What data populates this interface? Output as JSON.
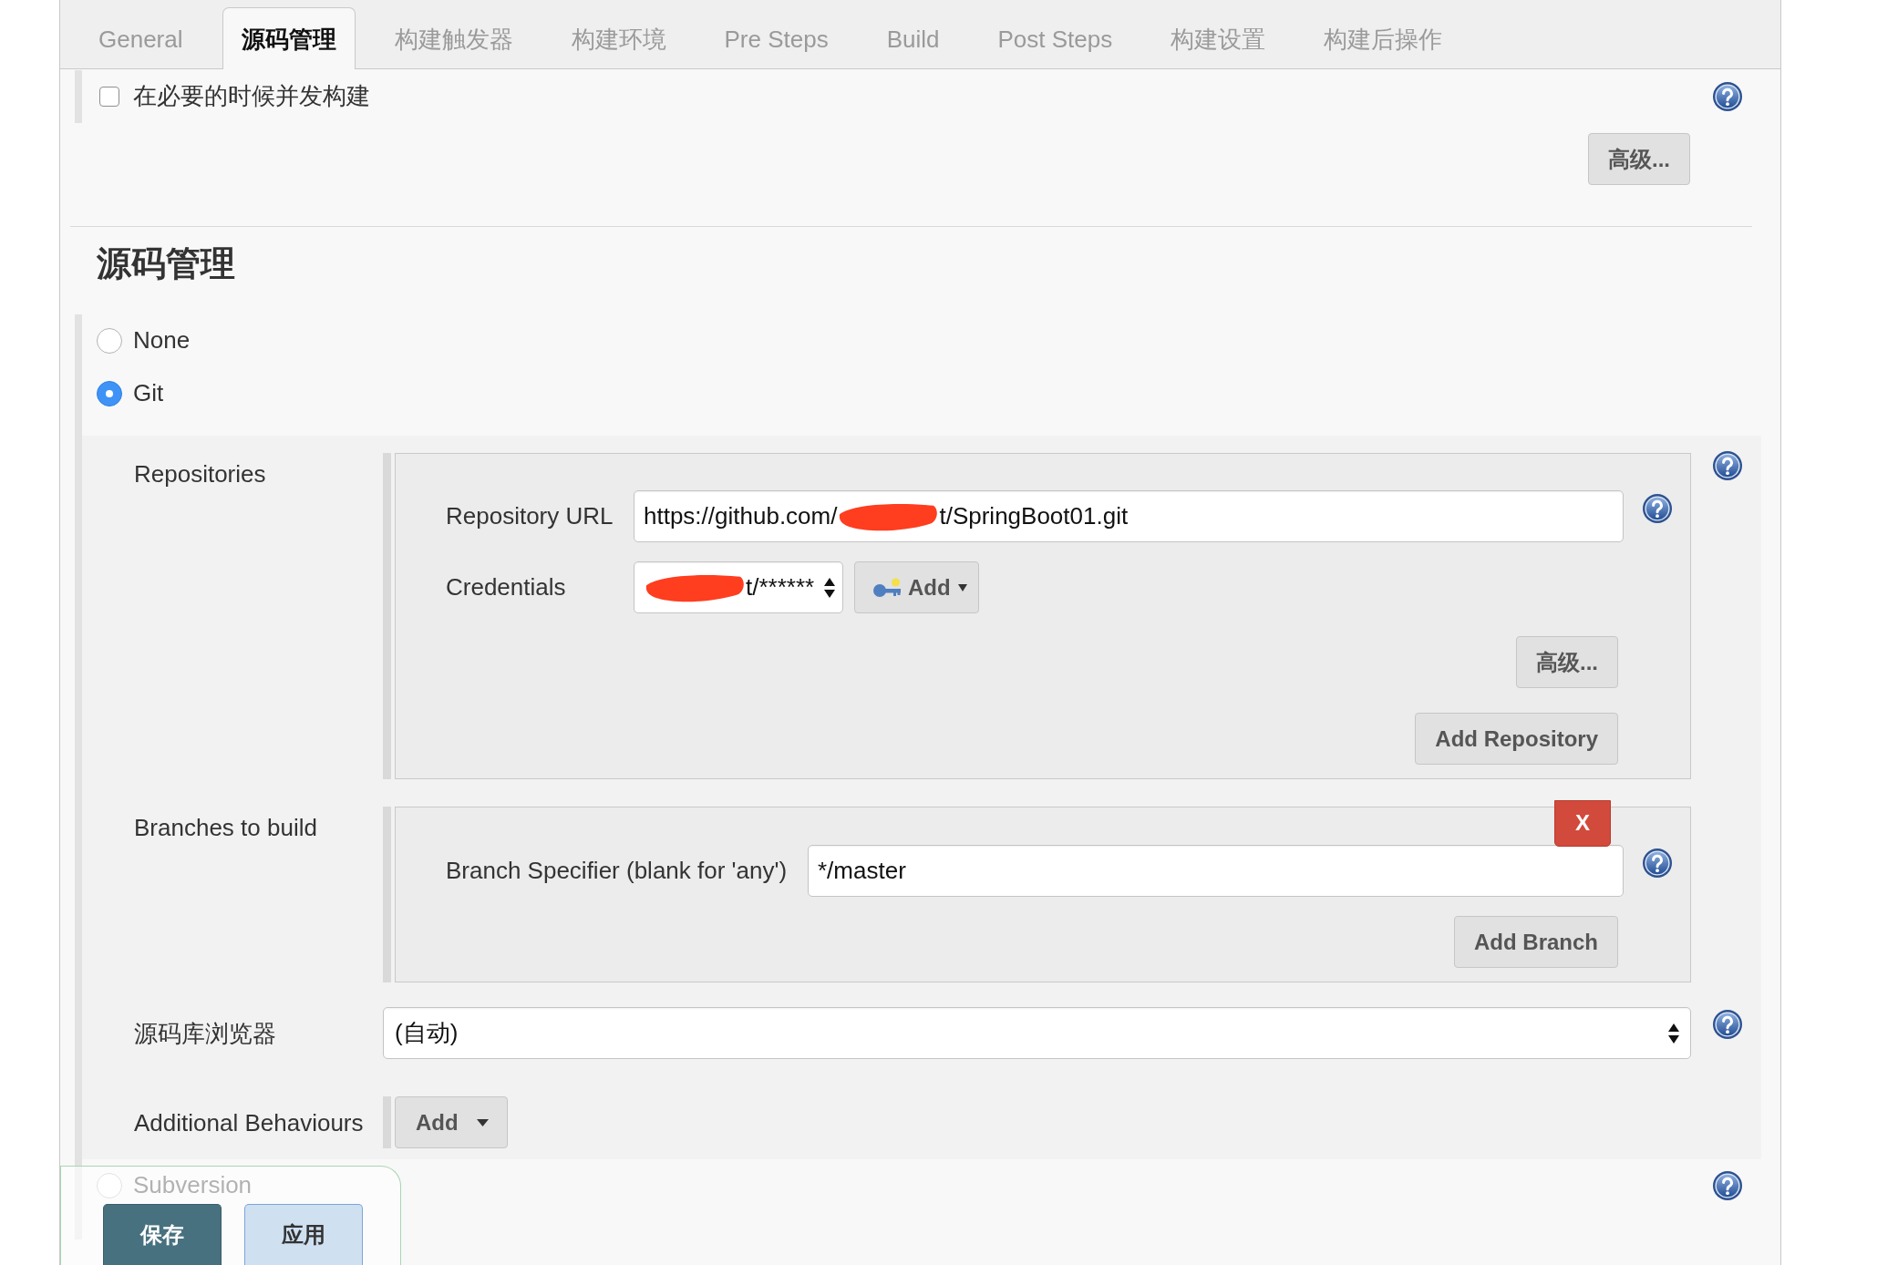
{
  "tabs": [
    {
      "label": "General",
      "selected": false
    },
    {
      "label": "源码管理",
      "selected": true
    },
    {
      "label": "构建触发器",
      "selected": false
    },
    {
      "label": "构建环境",
      "selected": false
    },
    {
      "label": "Pre Steps",
      "selected": false
    },
    {
      "label": "Build",
      "selected": false
    },
    {
      "label": "Post Steps",
      "selected": false
    },
    {
      "label": "构建设置",
      "selected": false
    },
    {
      "label": "构建后操作",
      "selected": false
    }
  ],
  "concurrent_build": {
    "label": "在必要的时候并发构建",
    "checked": false
  },
  "advanced_button": "高级...",
  "section_title": "源码管理",
  "scm_options": [
    {
      "kind": "none",
      "label": "None",
      "selected": false
    },
    {
      "kind": "git",
      "label": "Git",
      "selected": true
    },
    {
      "kind": "svn",
      "label": "Subversion",
      "selected": false
    }
  ],
  "git": {
    "repositories": {
      "label": "Repositories",
      "fields": [
        {
          "kind": "text",
          "label": "Repository URL",
          "segments": [
            {
              "kind": "text",
              "text": "https://github.com/"
            },
            {
              "kind": "redaction"
            },
            {
              "kind": "text",
              "text": "t/SpringBoot01.git"
            }
          ]
        },
        {
          "kind": "select",
          "label": "Credentials",
          "segments": [
            {
              "kind": "redaction"
            },
            {
              "kind": "text",
              "text": "t/******"
            }
          ],
          "add_button": "Add"
        }
      ],
      "advanced_button": "高级...",
      "add_button": "Add Repository"
    },
    "branches": {
      "label": "Branches to build",
      "remove_button": "X",
      "specifier": {
        "label": "Branch Specifier (blank for 'any')",
        "value": "*/master"
      },
      "add_button": "Add Branch"
    },
    "browser": {
      "label": "源码库浏览器",
      "value": "(自动)"
    },
    "behaviours": {
      "label": "Additional Behaviours",
      "add_button": "Add"
    }
  },
  "actions": [
    {
      "kind": "save",
      "label": "保存"
    },
    {
      "kind": "apply",
      "label": "应用"
    }
  ]
}
